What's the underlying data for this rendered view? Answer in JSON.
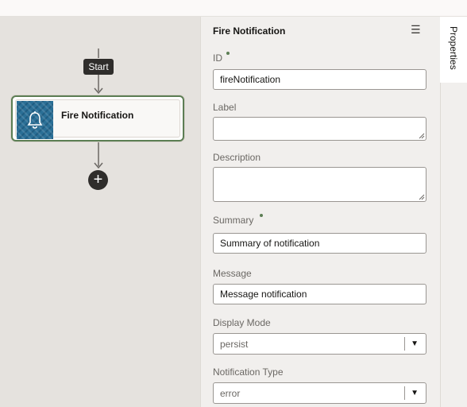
{
  "flow": {
    "start_label": "Start",
    "node": {
      "title": "Fire Notification",
      "icon": "bell-icon"
    },
    "add_icon": "plus-icon"
  },
  "panel": {
    "title": "Fire Notification",
    "menu_icon": "hamburger-icon",
    "fields": {
      "id": {
        "label": "ID",
        "value": "fireNotification",
        "required": true
      },
      "label": {
        "label": "Label",
        "value": ""
      },
      "description": {
        "label": "Description",
        "value": ""
      },
      "summary": {
        "label": "Summary",
        "value": "Summary of notification",
        "required": true
      },
      "message": {
        "label": "Message",
        "value": "Message notification"
      },
      "display_mode": {
        "label": "Display Mode",
        "value": "persist"
      },
      "notification_type": {
        "label": "Notification Type",
        "value": "error"
      }
    }
  },
  "side_tab": {
    "label": "Properties"
  },
  "colors": {
    "canvas_bg": "#e5e2de",
    "panel_bg": "#f1efed",
    "node_border": "#5c7e54",
    "chip_bg": "#2f2d2b",
    "required_dot": "#5c7e54"
  }
}
